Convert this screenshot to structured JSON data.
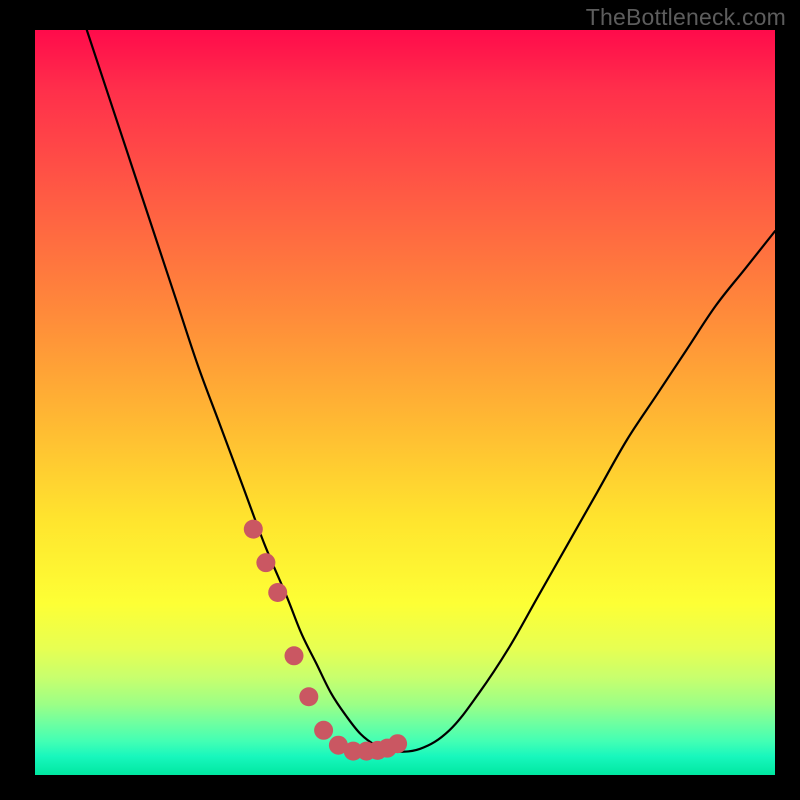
{
  "watermark": "TheBottleneck.com",
  "colors": {
    "bg": "#000000",
    "curve_stroke": "#000000",
    "marker_fill": "#ca5762",
    "marker_stroke": "#b84a55"
  },
  "chart_data": {
    "type": "line",
    "title": "",
    "xlabel": "",
    "ylabel": "",
    "xlim": [
      0,
      100
    ],
    "ylim": [
      0,
      100
    ],
    "grid": false,
    "x": [
      7,
      10,
      13,
      16,
      19,
      22,
      25,
      28,
      31,
      34,
      36,
      38,
      40,
      42,
      44,
      46,
      48,
      52,
      56,
      60,
      64,
      68,
      72,
      76,
      80,
      84,
      88,
      92,
      96,
      100
    ],
    "values": [
      100,
      91,
      82,
      73,
      64,
      55,
      47,
      39,
      31,
      24,
      19,
      15,
      11,
      8,
      5.5,
      4,
      3.2,
      3.5,
      6,
      11,
      17,
      24,
      31,
      38,
      45,
      51,
      57,
      63,
      68,
      73
    ],
    "markers": {
      "x": [
        29.5,
        31.2,
        32.8,
        35.0,
        37.0,
        39.0,
        41.0,
        43.0,
        44.8,
        46.3,
        47.6,
        49.0
      ],
      "y": [
        33.0,
        28.5,
        24.5,
        16.0,
        10.5,
        6.0,
        4.0,
        3.2,
        3.2,
        3.3,
        3.6,
        4.2
      ]
    }
  }
}
